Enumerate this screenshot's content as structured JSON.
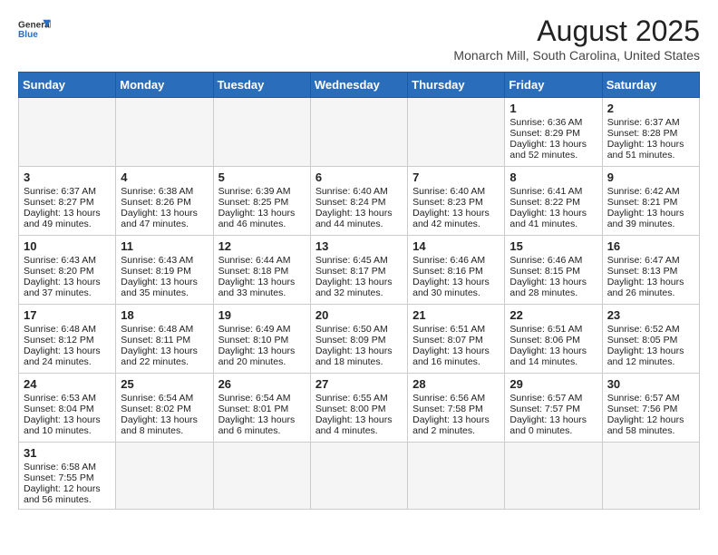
{
  "logo": {
    "line1": "General",
    "line2": "Blue"
  },
  "title": "August 2025",
  "subtitle": "Monarch Mill, South Carolina, United States",
  "days_of_week": [
    "Sunday",
    "Monday",
    "Tuesday",
    "Wednesday",
    "Thursday",
    "Friday",
    "Saturday"
  ],
  "weeks": [
    [
      {
        "day": "",
        "info": ""
      },
      {
        "day": "",
        "info": ""
      },
      {
        "day": "",
        "info": ""
      },
      {
        "day": "",
        "info": ""
      },
      {
        "day": "",
        "info": ""
      },
      {
        "day": "1",
        "info": "Sunrise: 6:36 AM\nSunset: 8:29 PM\nDaylight: 13 hours and 52 minutes."
      },
      {
        "day": "2",
        "info": "Sunrise: 6:37 AM\nSunset: 8:28 PM\nDaylight: 13 hours and 51 minutes."
      }
    ],
    [
      {
        "day": "3",
        "info": "Sunrise: 6:37 AM\nSunset: 8:27 PM\nDaylight: 13 hours and 49 minutes."
      },
      {
        "day": "4",
        "info": "Sunrise: 6:38 AM\nSunset: 8:26 PM\nDaylight: 13 hours and 47 minutes."
      },
      {
        "day": "5",
        "info": "Sunrise: 6:39 AM\nSunset: 8:25 PM\nDaylight: 13 hours and 46 minutes."
      },
      {
        "day": "6",
        "info": "Sunrise: 6:40 AM\nSunset: 8:24 PM\nDaylight: 13 hours and 44 minutes."
      },
      {
        "day": "7",
        "info": "Sunrise: 6:40 AM\nSunset: 8:23 PM\nDaylight: 13 hours and 42 minutes."
      },
      {
        "day": "8",
        "info": "Sunrise: 6:41 AM\nSunset: 8:22 PM\nDaylight: 13 hours and 41 minutes."
      },
      {
        "day": "9",
        "info": "Sunrise: 6:42 AM\nSunset: 8:21 PM\nDaylight: 13 hours and 39 minutes."
      }
    ],
    [
      {
        "day": "10",
        "info": "Sunrise: 6:43 AM\nSunset: 8:20 PM\nDaylight: 13 hours and 37 minutes."
      },
      {
        "day": "11",
        "info": "Sunrise: 6:43 AM\nSunset: 8:19 PM\nDaylight: 13 hours and 35 minutes."
      },
      {
        "day": "12",
        "info": "Sunrise: 6:44 AM\nSunset: 8:18 PM\nDaylight: 13 hours and 33 minutes."
      },
      {
        "day": "13",
        "info": "Sunrise: 6:45 AM\nSunset: 8:17 PM\nDaylight: 13 hours and 32 minutes."
      },
      {
        "day": "14",
        "info": "Sunrise: 6:46 AM\nSunset: 8:16 PM\nDaylight: 13 hours and 30 minutes."
      },
      {
        "day": "15",
        "info": "Sunrise: 6:46 AM\nSunset: 8:15 PM\nDaylight: 13 hours and 28 minutes."
      },
      {
        "day": "16",
        "info": "Sunrise: 6:47 AM\nSunset: 8:13 PM\nDaylight: 13 hours and 26 minutes."
      }
    ],
    [
      {
        "day": "17",
        "info": "Sunrise: 6:48 AM\nSunset: 8:12 PM\nDaylight: 13 hours and 24 minutes."
      },
      {
        "day": "18",
        "info": "Sunrise: 6:48 AM\nSunset: 8:11 PM\nDaylight: 13 hours and 22 minutes."
      },
      {
        "day": "19",
        "info": "Sunrise: 6:49 AM\nSunset: 8:10 PM\nDaylight: 13 hours and 20 minutes."
      },
      {
        "day": "20",
        "info": "Sunrise: 6:50 AM\nSunset: 8:09 PM\nDaylight: 13 hours and 18 minutes."
      },
      {
        "day": "21",
        "info": "Sunrise: 6:51 AM\nSunset: 8:07 PM\nDaylight: 13 hours and 16 minutes."
      },
      {
        "day": "22",
        "info": "Sunrise: 6:51 AM\nSunset: 8:06 PM\nDaylight: 13 hours and 14 minutes."
      },
      {
        "day": "23",
        "info": "Sunrise: 6:52 AM\nSunset: 8:05 PM\nDaylight: 13 hours and 12 minutes."
      }
    ],
    [
      {
        "day": "24",
        "info": "Sunrise: 6:53 AM\nSunset: 8:04 PM\nDaylight: 13 hours and 10 minutes."
      },
      {
        "day": "25",
        "info": "Sunrise: 6:54 AM\nSunset: 8:02 PM\nDaylight: 13 hours and 8 minutes."
      },
      {
        "day": "26",
        "info": "Sunrise: 6:54 AM\nSunset: 8:01 PM\nDaylight: 13 hours and 6 minutes."
      },
      {
        "day": "27",
        "info": "Sunrise: 6:55 AM\nSunset: 8:00 PM\nDaylight: 13 hours and 4 minutes."
      },
      {
        "day": "28",
        "info": "Sunrise: 6:56 AM\nSunset: 7:58 PM\nDaylight: 13 hours and 2 minutes."
      },
      {
        "day": "29",
        "info": "Sunrise: 6:57 AM\nSunset: 7:57 PM\nDaylight: 13 hours and 0 minutes."
      },
      {
        "day": "30",
        "info": "Sunrise: 6:57 AM\nSunset: 7:56 PM\nDaylight: 12 hours and 58 minutes."
      }
    ],
    [
      {
        "day": "31",
        "info": "Sunrise: 6:58 AM\nSunset: 7:55 PM\nDaylight: 12 hours and 56 minutes."
      },
      {
        "day": "",
        "info": ""
      },
      {
        "day": "",
        "info": ""
      },
      {
        "day": "",
        "info": ""
      },
      {
        "day": "",
        "info": ""
      },
      {
        "day": "",
        "info": ""
      },
      {
        "day": "",
        "info": ""
      }
    ]
  ]
}
